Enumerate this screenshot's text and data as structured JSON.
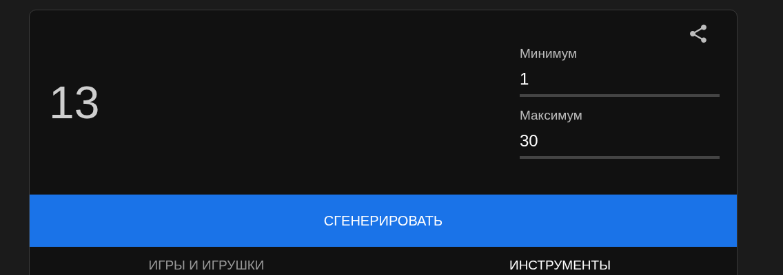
{
  "result": "13",
  "fields": [
    {
      "label": "Минимум",
      "value": "1"
    },
    {
      "label": "Максимум",
      "value": "30"
    }
  ],
  "generate_button": "СГЕНЕРИРОВАТЬ",
  "tabs": [
    {
      "label": "ИГРЫ И ИГРУШКИ",
      "selected": false
    },
    {
      "label": "ИНСТРУМЕНТЫ",
      "selected": true
    }
  ]
}
